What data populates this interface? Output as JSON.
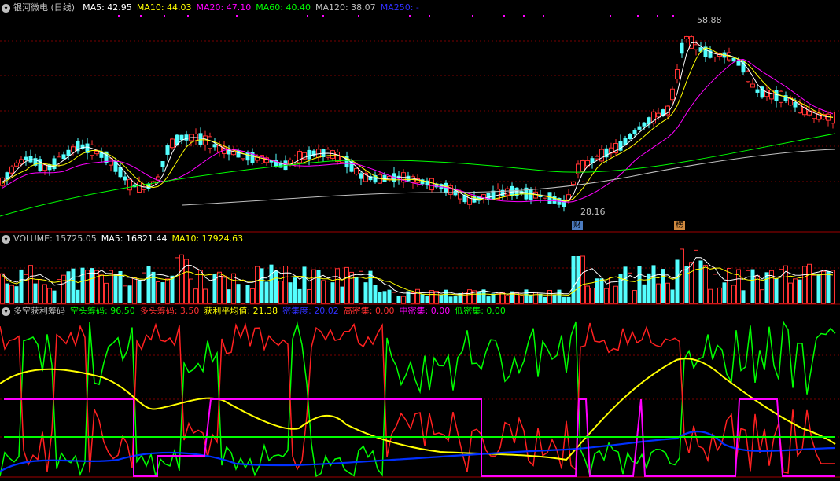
{
  "price_panel": {
    "title": "银河微电 (日线)",
    "indicators": [
      {
        "label": "MA5: 42.95",
        "color": "#ffffff"
      },
      {
        "label": "MA10: 44.03",
        "color": "#ffff00"
      },
      {
        "label": "MA20: 47.10",
        "color": "#ff00ff"
      },
      {
        "label": "MA60: 40.40",
        "color": "#00ff00"
      },
      {
        "label": "MA120: 38.07",
        "color": "#c0c0c0"
      },
      {
        "label": "MA250: -",
        "color": "#3030ff"
      }
    ],
    "high_label": "58.88",
    "low_label": "28.16",
    "event_tags": [
      "财",
      "榜"
    ]
  },
  "volume_panel": {
    "indicators": [
      {
        "label": "VOLUME: 15725.05",
        "color": "#c0c0c0"
      },
      {
        "label": "MA5: 16821.44",
        "color": "#ffffff"
      },
      {
        "label": "MA10: 17924.63",
        "color": "#ffff00"
      }
    ]
  },
  "chip_panel": {
    "title": "多空获利筹码",
    "indicators": [
      {
        "label": "空头筹码: 96.50",
        "color": "#00ff00"
      },
      {
        "label": "多头筹码: 3.50",
        "color": "#ff3030"
      },
      {
        "label": "获利平均值: 21.38",
        "color": "#ffff00"
      },
      {
        "label": "密集度: 20.02",
        "color": "#3030ff"
      },
      {
        "label": "高密集: 0.00",
        "color": "#ff3030"
      },
      {
        "label": "中密集: 0.00",
        "color": "#ff00ff"
      },
      {
        "label": "低密集: 0.00",
        "color": "#00ff00"
      }
    ]
  },
  "colors": {
    "up": "#ff3232",
    "down": "#54ffff",
    "grid": "#7a0000",
    "border": "#a00000"
  }
}
